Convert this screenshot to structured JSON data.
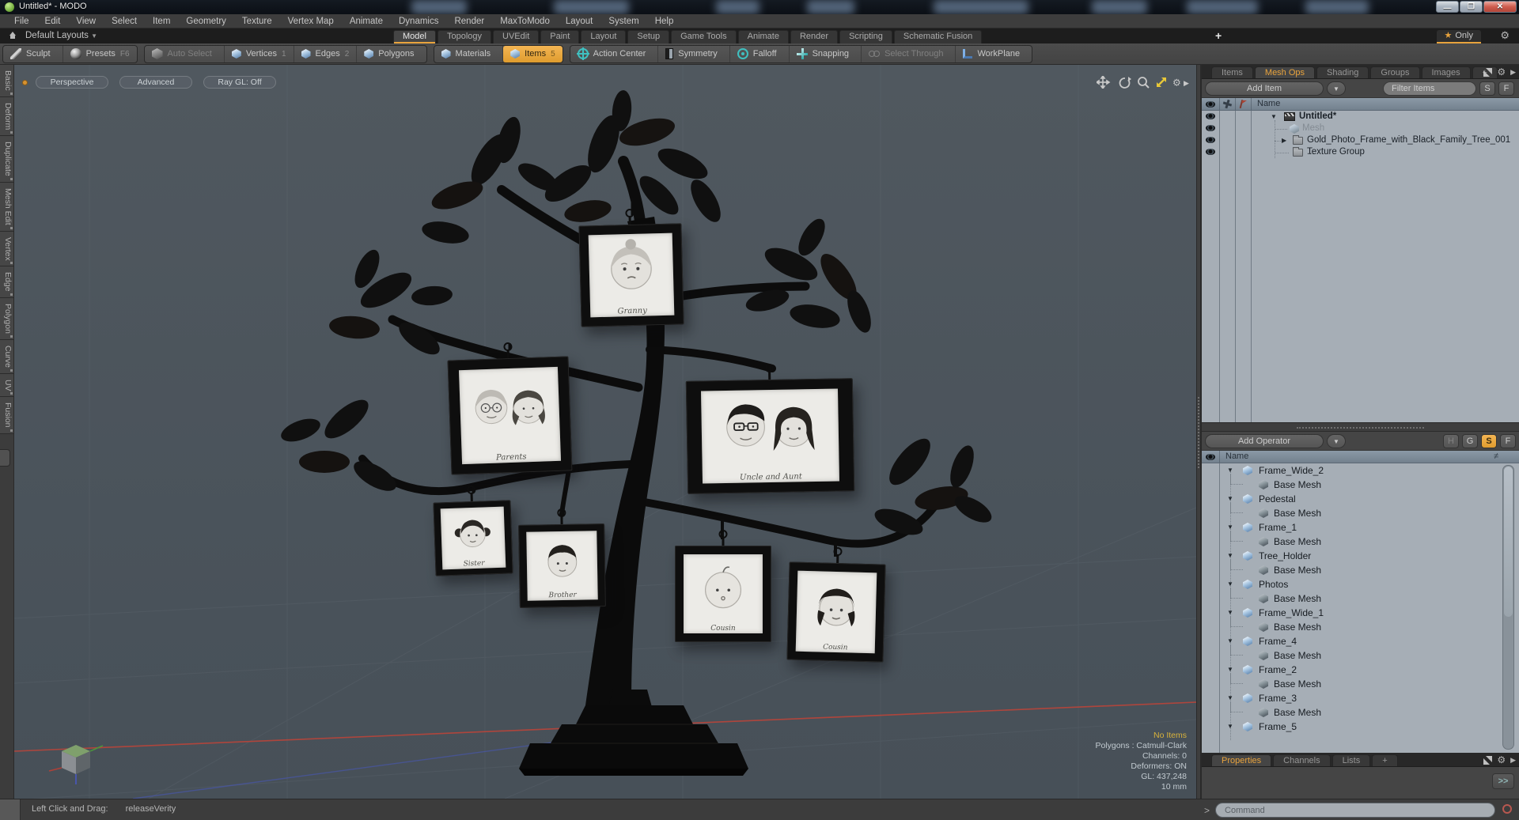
{
  "window": {
    "title": "Untitled* - MODO"
  },
  "menu_bar": {
    "items": [
      "File",
      "Edit",
      "View",
      "Select",
      "Item",
      "Geometry",
      "Texture",
      "Vertex Map",
      "Animate",
      "Dynamics",
      "Render",
      "MaxToModo",
      "Layout",
      "System",
      "Help"
    ]
  },
  "layout_bar": {
    "switcher_label": "Default Layouts",
    "tabs": [
      {
        "label": "Model",
        "active": true
      },
      {
        "label": "Topology"
      },
      {
        "label": "UVEdit"
      },
      {
        "label": "Paint"
      },
      {
        "label": "Layout"
      },
      {
        "label": "Setup"
      },
      {
        "label": "Game Tools"
      },
      {
        "label": "Animate"
      },
      {
        "label": "Render"
      },
      {
        "label": "Scripting"
      },
      {
        "label": "Schematic Fusion"
      }
    ],
    "add_tab": "+",
    "only_label": "Only"
  },
  "toolbar": {
    "group1": [
      {
        "label": "Sculpt",
        "icon": "pencil"
      },
      {
        "label": "Presets",
        "num": "F6",
        "icon": "sphere"
      }
    ],
    "group2": [
      {
        "label": "Auto Select",
        "icon": "cube-dim",
        "state": "disabled"
      },
      {
        "label": "Vertices",
        "num": "1",
        "icon": "cube"
      },
      {
        "label": "Edges",
        "num": "2",
        "icon": "cube"
      },
      {
        "label": "Polygons",
        "icon": "cube"
      }
    ],
    "group3": [
      {
        "label": "Materials",
        "icon": "cube"
      },
      {
        "label": "Items",
        "num": "5",
        "icon": "cube",
        "state": "active"
      }
    ],
    "group4": [
      {
        "label": "Action Center",
        "icon": "action-center"
      },
      {
        "label": "Symmetry",
        "icon": "symmetry"
      },
      {
        "label": "Falloff",
        "icon": "falloff"
      },
      {
        "label": "Snapping",
        "icon": "snapping"
      },
      {
        "label": "Select Through",
        "icon": "select-through",
        "state": "disabled"
      },
      {
        "label": "WorkPlane",
        "icon": "workplane"
      }
    ]
  },
  "left_tabs": [
    "Basic",
    "Deform",
    "Duplicate",
    "Mesh Edit",
    "Vertex",
    "Edge",
    "Polygon",
    "Curve",
    "UV",
    "Fusion"
  ],
  "viewport": {
    "buttons": [
      {
        "label": "Perspective"
      },
      {
        "label": "Advanced"
      },
      {
        "label": "Ray GL: Off"
      }
    ],
    "info": [
      {
        "text": "No Items",
        "highlight": true
      },
      {
        "text": "Polygons : Catmull-Clark"
      },
      {
        "text": "Channels: 0"
      },
      {
        "text": "Deformers: ON"
      },
      {
        "text": "GL: 437,248"
      },
      {
        "text": "10 mm"
      }
    ]
  },
  "model": {
    "frames": [
      {
        "caption": "Granny"
      },
      {
        "caption": "Parents"
      },
      {
        "caption": "Uncle and Aunt"
      },
      {
        "caption": "Sister"
      },
      {
        "caption": "Brother"
      },
      {
        "caption": "Cousin"
      },
      {
        "caption": "Cousin"
      }
    ]
  },
  "items_panel": {
    "tabs": [
      {
        "label": "Items"
      },
      {
        "label": "Mesh Ops",
        "active": true
      },
      {
        "label": "Shading"
      },
      {
        "label": "Groups"
      },
      {
        "label": "Images"
      },
      {
        "label": "+"
      }
    ],
    "add_item_label": "Add Item",
    "filter_placeholder": "Filter Items",
    "btn_s": "S",
    "btn_f": "F",
    "name_header": "Name",
    "tree": {
      "root": "Untitled*",
      "mesh": "Mesh",
      "folder1": "Gold_Photo_Frame_with_Black_Family_Tree_001 ...",
      "folder2": "Texture Group"
    }
  },
  "mesh_ops_panel": {
    "add_operator_label": "Add Operator",
    "buttons": [
      {
        "label": "H",
        "state": "disabled"
      },
      {
        "label": "G"
      },
      {
        "label": "S",
        "state": "active"
      },
      {
        "label": "F"
      }
    ],
    "name_header": "Name",
    "rows": [
      {
        "label": "Frame_Wide_2",
        "kind": "parent"
      },
      {
        "label": "Base Mesh",
        "kind": "child"
      },
      {
        "label": "Pedestal",
        "kind": "parent"
      },
      {
        "label": "Base Mesh",
        "kind": "child"
      },
      {
        "label": "Frame_1",
        "kind": "parent"
      },
      {
        "label": "Base Mesh",
        "kind": "child"
      },
      {
        "label": "Tree_Holder",
        "kind": "parent"
      },
      {
        "label": "Base Mesh",
        "kind": "child"
      },
      {
        "label": "Photos",
        "kind": "parent"
      },
      {
        "label": "Base Mesh",
        "kind": "child"
      },
      {
        "label": "Frame_Wide_1",
        "kind": "parent"
      },
      {
        "label": "Base Mesh",
        "kind": "child"
      },
      {
        "label": "Frame_4",
        "kind": "parent"
      },
      {
        "label": "Base Mesh",
        "kind": "child"
      },
      {
        "label": "Frame_2",
        "kind": "parent"
      },
      {
        "label": "Base Mesh",
        "kind": "child"
      },
      {
        "label": "Frame_3",
        "kind": "parent"
      },
      {
        "label": "Base Mesh",
        "kind": "child"
      },
      {
        "label": "Frame_5",
        "kind": "parent"
      }
    ]
  },
  "bottom_panel": {
    "tabs": [
      {
        "label": "Properties",
        "active": true
      },
      {
        "label": "Channels"
      },
      {
        "label": "Lists"
      },
      {
        "label": "+"
      }
    ],
    "more_label": ">>"
  },
  "command_bar": {
    "status_label": "Left Click and Drag:",
    "status_value": "releaseVerity",
    "prompt": ">",
    "input_placeholder": "Command"
  },
  "colors": {
    "accent": "#e8a33d",
    "viewport_bg": "#4d565e",
    "list_bg": "#a6aeb6",
    "info_highlight": "#d8b23c"
  }
}
